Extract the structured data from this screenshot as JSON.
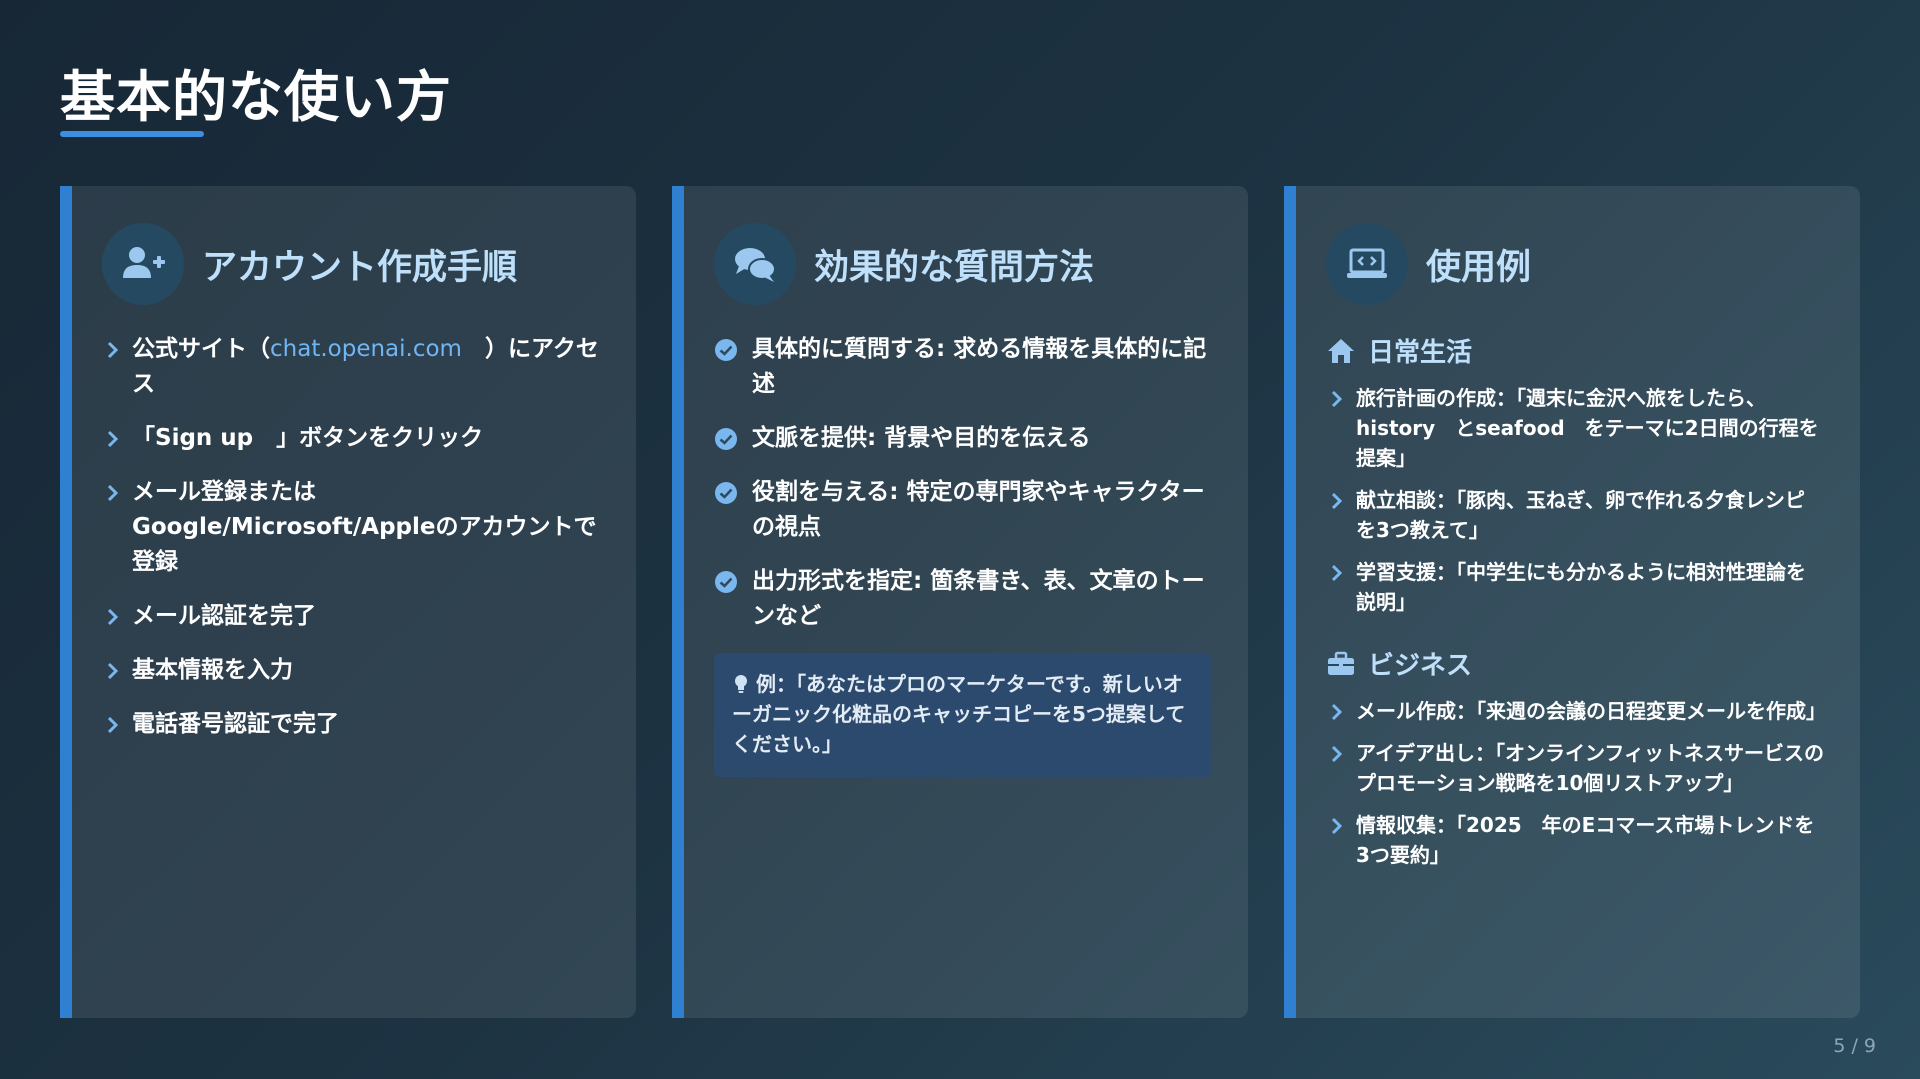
{
  "slide": {
    "title": "基本的な使い方",
    "page_number": "5 / 9"
  },
  "colors": {
    "accent": "#2f80d0",
    "card_title": "#bfe0fb",
    "link": "#6fb6f4"
  },
  "cards": {
    "account": {
      "icon": "user-plus-icon",
      "title": "アカウント作成手順",
      "step1_prefix": "公式サイト（",
      "step1_link": "chat.openai.com",
      "step1_suffix": "　）にアクセス",
      "steps": [
        "「Sign up　」ボタンをクリック",
        "メール登録またはGoogle/Microsoft/Appleのアカウントで登録",
        "メール認証を完了",
        "基本情報を入力",
        "電話番号認証で完了"
      ]
    },
    "questions": {
      "icon": "chat-bubbles-icon",
      "title": "効果的な質問方法",
      "tips": [
        "具体的に質問する: 求める情報を具体的に記述",
        "文脈を提供: 背景や目的を伝える",
        "役割を与える: 特定の専門家やキャラクターの視点",
        "出力形式を指定: 箇条書き、表、文章のトーンなど"
      ],
      "example": "例：「あなたはプロのマーケターです。新しいオーガニック化粧品のキャッチコピーを5つ提案してください。」"
    },
    "examples": {
      "icon": "laptop-code-icon",
      "title": "使用例",
      "daily_heading": "日常生活",
      "daily_items": [
        "旅行計画の作成：「週末に金沢へ旅をしたら、history　とseafood　をテーマに2日間の行程を提案」",
        "献立相談：「豚肉、玉ねぎ、卵で作れる夕食レシピを3つ教えて」",
        "学習支援：「中学生にも分かるように相対性理論を説明」"
      ],
      "business_heading": "ビジネス",
      "business_items": [
        "メール作成：「来週の会議の日程変更メールを作成」",
        "アイデア出し：「オンラインフィットネスサービスのプロモーション戦略を10個リストアップ」",
        "情報収集：「2025　年のEコマース市場トレンドを3つ要約」"
      ]
    }
  }
}
